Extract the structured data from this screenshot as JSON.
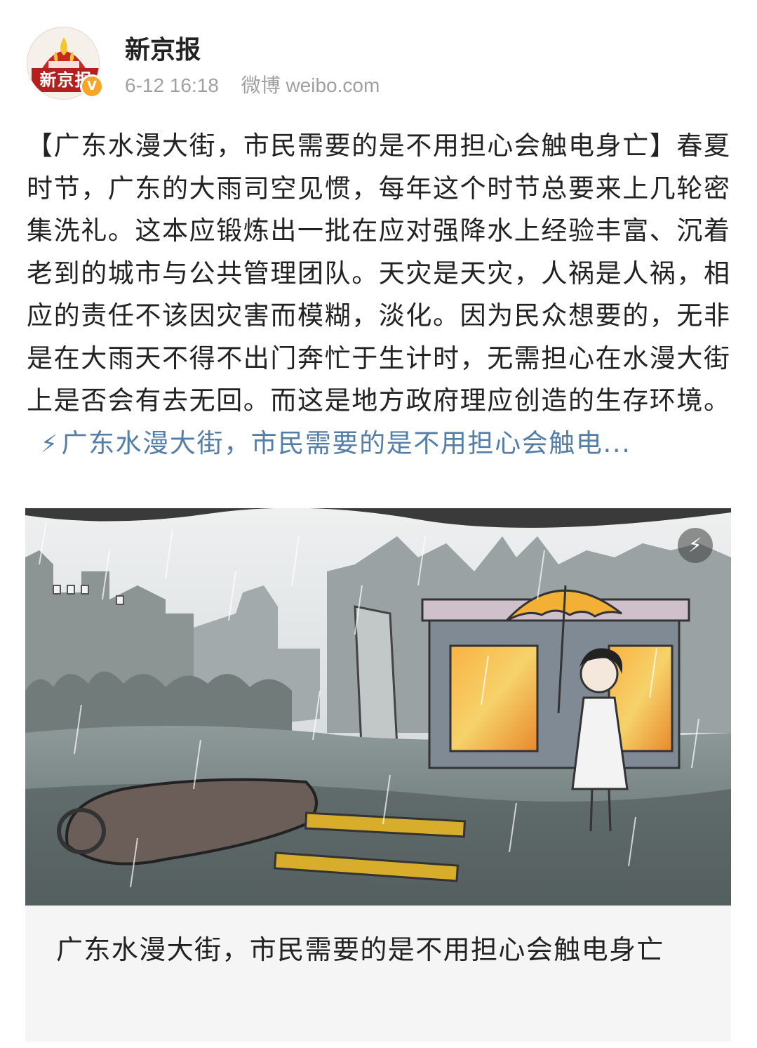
{
  "account": {
    "name": "新京报",
    "avatar_text": "新京报",
    "verified_mark": "V",
    "time": "6-12 16:18",
    "source": "微博 weibo.com"
  },
  "post": {
    "text": "【广东水漫大街，市民需要的是不用担心会触电身亡】春夏时节，广东的大雨司空见惯，每年这个时节总要来上几轮密集洗礼。这本应锻炼出一批在应对强降水上经验丰富、沉着老到的城市与公共管理团队。天灾是天灾，人祸是人祸，相应的责任不该因灾害而模糊，淡化。因为民众想要的，无非是在大雨天不得不出门奔忙于生计时，无需担心在水漫大街上是否会有去无回。而这是地方政府理应创造的生存环境。",
    "link_icon": "⚡",
    "link_text": "广东水漫大街，市民需要的是不用担心会触电..."
  },
  "card": {
    "play_icon": "⚡",
    "title": "广东水漫大街，市民需要的是不用担心会触电身亡"
  },
  "colors": {
    "link": "#547ea8",
    "meta": "#a0a0a0",
    "brand_red": "#b3201d",
    "verified": "#f7a428"
  }
}
